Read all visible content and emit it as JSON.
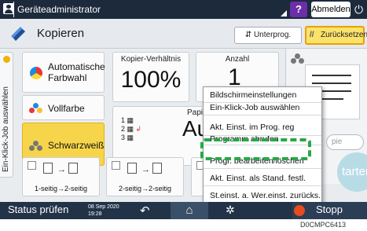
{
  "titlebar": {
    "user_name": "Geräteadministrator",
    "help_label": "?",
    "logout_label": "Abmelden"
  },
  "header": {
    "app_title": "Kopieren",
    "program_label": "Unterprog.",
    "reset_label": "Zurücksetzen"
  },
  "side_tab": {
    "label": "Ein-Klick-Job auswählen"
  },
  "color_buttons": {
    "auto_color": "Automatische Farbwahl",
    "full_color": "Vollfarbe",
    "black_white": "Schwarzweiß"
  },
  "copy_ratio": {
    "label": "Kopier-Verhältnis",
    "value": "100%"
  },
  "quantity": {
    "label": "Anzahl",
    "value": "1"
  },
  "paper": {
    "label": "Papier",
    "value": "Au",
    "trays": [
      "1",
      "2",
      "3"
    ]
  },
  "menu": {
    "items": [
      "Bildschirmeinstellungen",
      "Ein-Klick-Job auswählen",
      "Akt. Einst. im Prog. reg",
      "Programm abrufen",
      "Progr. bearbeiten/löschen",
      "Akt. Einst. als Stand. festl.",
      "St.einst. a. Wer.einst. zurücks."
    ],
    "highlighted_index": 2
  },
  "duplex_buttons": [
    "1-seitig→2-seitig",
    "2-seitig→2-seitig"
  ],
  "side_field": {
    "placeholder": "pie"
  },
  "start": {
    "label": "tarten"
  },
  "statusbar": {
    "status_label": "Status prüfen",
    "date": "08 Sep 2020",
    "time": "19:28",
    "stop_label": "Stopp"
  },
  "image_code": "D0CMPC6413",
  "colors": {
    "titlebar": "#1c2a3c",
    "statusbar": "#223348",
    "active_button": "#f7d54a",
    "highlight_border": "#27a845",
    "help_button": "#6b2fa8",
    "stop_button": "#e84b1d"
  }
}
